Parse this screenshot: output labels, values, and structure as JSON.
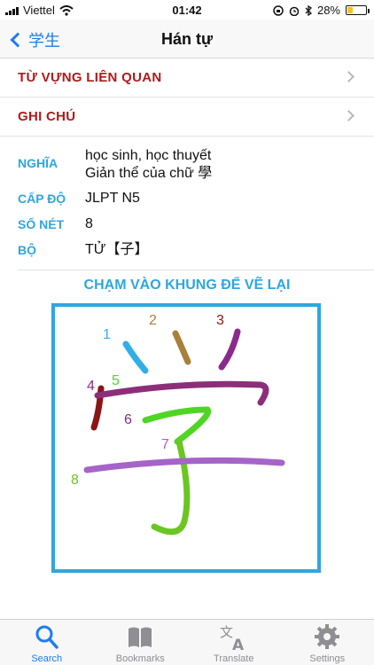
{
  "status": {
    "carrier": "Viettel",
    "time": "01:42",
    "battery_text": "28%",
    "battery_level": 0.28
  },
  "nav": {
    "back_label": "学生",
    "title": "Hán tự"
  },
  "links": [
    {
      "label": "TỪ VỰNG LIÊN QUAN"
    },
    {
      "label": "GHI CHÚ"
    }
  ],
  "details": {
    "meaning_key": "NGHĨA",
    "meaning_line1": "học sinh, học thuyết",
    "meaning_line2": "Giản thể của chữ 學",
    "level_key": "CẤP ĐỘ",
    "level_value": "JLPT N5",
    "strokes_key": "SỐ NÉT",
    "strokes_value": "8",
    "radical_key": "BỘ",
    "radical_value": "TỬ【子】"
  },
  "drawing": {
    "caption": "CHẠM VÀO KHUNG ĐỂ VẼ LẠI",
    "stroke_numbers": [
      "1",
      "2",
      "3",
      "4",
      "5",
      "6",
      "7",
      "8"
    ],
    "stroke_colors": [
      "#32aee6",
      "#a8803a",
      "#8b2a8c",
      "#8c1414",
      "#8c2f7a",
      "#4fd624",
      "#6bc623",
      "#a564c8"
    ],
    "number_colors": [
      "#32aee6",
      "#a8803a",
      "#8c1414",
      "#8b2a8c",
      "#4fd624",
      "#8b2a8c",
      "#a564c8",
      "#6bc623"
    ]
  },
  "tabs": [
    {
      "label": "Search",
      "icon": "search-icon",
      "active": true
    },
    {
      "label": "Bookmarks",
      "icon": "book-icon",
      "active": false
    },
    {
      "label": "Translate",
      "icon": "translate-icon",
      "active": false
    },
    {
      "label": "Settings",
      "icon": "gear-icon",
      "active": false
    }
  ],
  "colors": {
    "accent_blue": "#1e7cf2",
    "header_red": "#b01a1a",
    "label_cyan": "#2ea6e0"
  }
}
